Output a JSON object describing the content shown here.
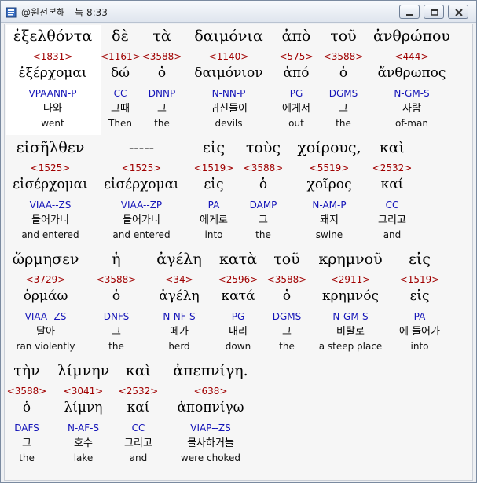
{
  "window": {
    "title": "@원전본해 - 눅 8:33"
  },
  "rows": [
    {
      "words": [
        {
          "greek": "ἐξελθόντα",
          "strong": "<1831>",
          "lemma": "ἐξέρχομαι",
          "parse": "VPAANN-P",
          "kor": "나와",
          "eng": "went"
        },
        {
          "greek": "δὲ",
          "strong": "<1161>",
          "lemma": "δώ",
          "parse": "CC",
          "kor": "그때",
          "eng": "Then"
        },
        {
          "greek": "τὰ",
          "strong": "<3588>",
          "lemma": "ὁ",
          "parse": "DNNP",
          "kor": "그",
          "eng": "the"
        },
        {
          "greek": "δαιμόνια",
          "strong": "<1140>",
          "lemma": "δαιμόνιον",
          "parse": "N-NN-P",
          "kor": "귀신들이",
          "eng": "devils"
        },
        {
          "greek": "ἀπὸ",
          "strong": "<575>",
          "lemma": "ἀπό",
          "parse": "PG",
          "kor": "에게서",
          "eng": "out"
        },
        {
          "greek": "τοῦ",
          "strong": "<3588>",
          "lemma": "ὁ",
          "parse": "DGMS",
          "kor": "그",
          "eng": "the"
        },
        {
          "greek": "ἀνθρώπου",
          "strong": "<444>",
          "lemma": "ἄνθρωπος",
          "parse": "N-GM-S",
          "kor": "사람",
          "eng": "of-man"
        }
      ]
    },
    {
      "words": [
        {
          "greek": "εἰσῆλθεν",
          "strong": "<1525>",
          "lemma": "εἰσέρχομαι",
          "parse": "VIAA--ZS",
          "kor": "들어가니",
          "eng": "and entered"
        },
        {
          "greek": "-----",
          "strong": "<1525>",
          "lemma": "εἰσέρχομαι",
          "parse": "VIAA--ZP",
          "kor": "들어가니",
          "eng": "and entered"
        },
        {
          "greek": "εἰς",
          "strong": "<1519>",
          "lemma": "εἰς",
          "parse": "PA",
          "kor": "에게로",
          "eng": "into"
        },
        {
          "greek": "τοὺς",
          "strong": "<3588>",
          "lemma": "ὁ",
          "parse": "DAMP",
          "kor": "그",
          "eng": "the"
        },
        {
          "greek": "χοίρους,",
          "strong": "<5519>",
          "lemma": "χοῖρος",
          "parse": "N-AM-P",
          "kor": "돼지",
          "eng": "swine"
        },
        {
          "greek": "καὶ",
          "strong": "<2532>",
          "lemma": "καί",
          "parse": "CC",
          "kor": "그리고",
          "eng": "and"
        }
      ]
    },
    {
      "words": [
        {
          "greek": "ὥρμησεν",
          "strong": "<3729>",
          "lemma": "ὁρμάω",
          "parse": "VIAA--ZS",
          "kor": "달아",
          "eng": "ran violently"
        },
        {
          "greek": "ἡ",
          "strong": "<3588>",
          "lemma": "ὁ",
          "parse": "DNFS",
          "kor": "그",
          "eng": "the"
        },
        {
          "greek": "ἀγέλη",
          "strong": "<34>",
          "lemma": "ἀγέλη",
          "parse": "N-NF-S",
          "kor": "떼가",
          "eng": "herd"
        },
        {
          "greek": "κατὰ",
          "strong": "<2596>",
          "lemma": "κατά",
          "parse": "PG",
          "kor": "내리",
          "eng": "down"
        },
        {
          "greek": "τοῦ",
          "strong": "<3588>",
          "lemma": "ὁ",
          "parse": "DGMS",
          "kor": "그",
          "eng": "the"
        },
        {
          "greek": "κρημνοῦ",
          "strong": "<2911>",
          "lemma": "κρημνός",
          "parse": "N-GM-S",
          "kor": "비탈로",
          "eng": "a steep place"
        },
        {
          "greek": "εἰς",
          "strong": "<1519>",
          "lemma": "εἰς",
          "parse": "PA",
          "kor": "에 들어가",
          "eng": "into"
        }
      ]
    },
    {
      "words": [
        {
          "greek": "τὴν",
          "strong": "<3588>",
          "lemma": "ὁ",
          "parse": "DAFS",
          "kor": "그",
          "eng": "the"
        },
        {
          "greek": "λίμνην",
          "strong": "<3041>",
          "lemma": "λίμνη",
          "parse": "N-AF-S",
          "kor": "호수",
          "eng": "lake"
        },
        {
          "greek": "καὶ",
          "strong": "<2532>",
          "lemma": "καί",
          "parse": "CC",
          "kor": "그리고",
          "eng": "and"
        },
        {
          "greek": "ἀπεπνίγη.",
          "strong": "<638>",
          "lemma": "ἀποπνίγω",
          "parse": "VIAP--ZS",
          "kor": "몰사하거늘",
          "eng": "were choked"
        }
      ]
    }
  ]
}
